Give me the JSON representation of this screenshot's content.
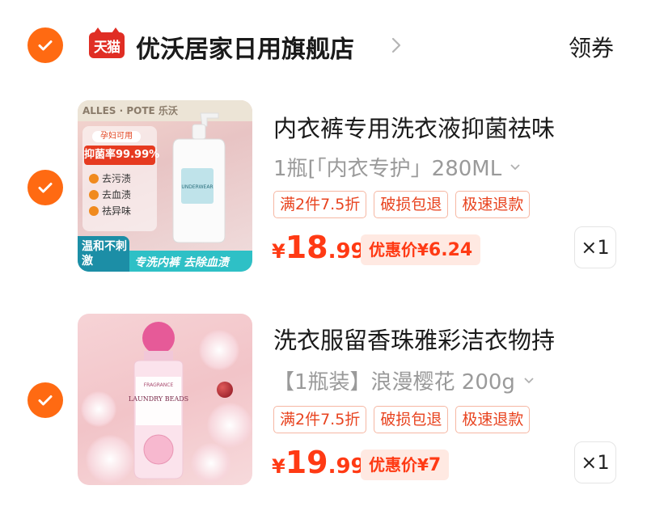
{
  "store": {
    "badge": "天猫",
    "name": "优沃居家日用旗舰店",
    "coupon": "领券"
  },
  "products": [
    {
      "title": "内衣裤专用洗衣液抑菌祛味",
      "sku": "1瓶[「内衣专护」280ML",
      "tags": [
        "满2件7.5折",
        "破损包退",
        "极速退款"
      ],
      "price": {
        "currency": "¥",
        "integer": "18",
        "decimal": ".99"
      },
      "promo": {
        "label": "优惠价¥",
        "value": "6.24"
      },
      "qty": "×1",
      "image_text": {
        "brand": "ALLES · POTE 乐沃",
        "badge": "孕妇可用",
        "rate": "抑菌率99.99%",
        "features": [
          "去污渍",
          "去血渍",
          "祛异味"
        ],
        "corner": "温和不刺激",
        "slogan": "专洗内裤 去除血渍",
        "bottle_label": "UNDERWEAR"
      }
    },
    {
      "title": "洗衣服留香珠雅彩洁衣物持",
      "sku": "【1瓶装】浪漫樱花 200g",
      "tags": [
        "满2件7.5折",
        "破损包退",
        "极速退款"
      ],
      "price": {
        "currency": "¥",
        "integer": "19",
        "decimal": ".99"
      },
      "promo": {
        "label": "优惠价¥",
        "value": "7"
      },
      "qty": "×1",
      "image_text": {
        "label_top": "FRAGRANCE",
        "label_main": "LAUNDRY BEADS"
      }
    }
  ],
  "colors": {
    "accent": "#ff6a12",
    "price": "#ff3a14",
    "tmall": "#e02e24",
    "tag_border": "#f6b7a3",
    "promo_bg": "#ffe9e2"
  }
}
